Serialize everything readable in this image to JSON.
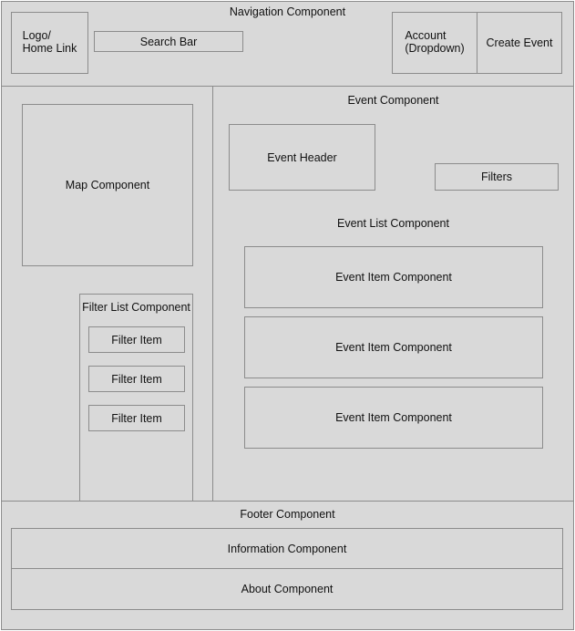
{
  "navigation": {
    "title": "Navigation Component",
    "logo": "Logo/\nHome Link",
    "search": "Search Bar",
    "account": "Account\n(Dropdown)",
    "create_event": "Create Event"
  },
  "sidebar": {
    "map": "Map Component",
    "filter_list": {
      "title": "Filter List Component",
      "items": [
        "Filter Item",
        "Filter Item",
        "Filter Item"
      ]
    }
  },
  "event": {
    "title": "Event Component",
    "header": "Event Header",
    "filters": "Filters",
    "list": {
      "title": "Event List Component",
      "items": [
        "Event Item Component",
        "Event Item Component",
        "Event Item Component"
      ]
    }
  },
  "footer": {
    "title": "Footer Component",
    "information": "Information Component",
    "about": "About Component"
  }
}
